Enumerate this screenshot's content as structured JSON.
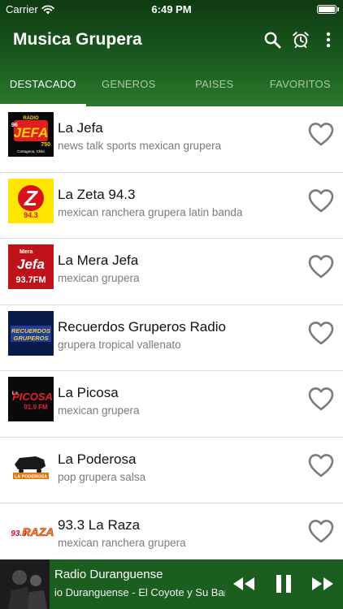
{
  "status": {
    "carrier": "Carrier",
    "time": "6:49 PM"
  },
  "app": {
    "title": "Musica Grupera"
  },
  "tabs": [
    {
      "label": "DESTACADO",
      "active": true
    },
    {
      "label": "GENEROS",
      "active": false
    },
    {
      "label": "PAISES",
      "active": false
    },
    {
      "label": "FAVORITOS",
      "active": false
    }
  ],
  "stations": [
    {
      "name": "La Jefa",
      "tags": "news talk sports mexican grupera"
    },
    {
      "name": "La Zeta 94.3",
      "tags": "mexican ranchera grupera latin banda"
    },
    {
      "name": "La Mera Jefa",
      "tags": "mexican grupera"
    },
    {
      "name": "Recuerdos Gruperos Radio",
      "tags": "grupera tropical vallenato"
    },
    {
      "name": "La Picosa",
      "tags": "mexican grupera"
    },
    {
      "name": "La Poderosa",
      "tags": "pop grupera salsa"
    },
    {
      "name": "93.3 La Raza",
      "tags": "mexican ranchera grupera"
    }
  ],
  "logos": {
    "jefa": {
      "top": "RADIO",
      "main": "JEFA",
      "num1": "96",
      "num2": "750",
      "sub": "Cartagena, Chile"
    },
    "zeta": {
      "main": "Z",
      "num": "94.3"
    },
    "mera": {
      "top": "Mera",
      "main": "Jefa",
      "num": "93.7FM"
    },
    "recuerdos": {
      "line1": "RECUERDOS",
      "line2": "GRUPEROS"
    },
    "picosa": {
      "pre": "La",
      "main": "PICOSA",
      "num": "91.9 FM"
    },
    "poderosa": {
      "main": "LA PODEROSA"
    },
    "raza": {
      "num": "93.3",
      "main": "RAZA"
    }
  },
  "player": {
    "title": "Radio Duranguense",
    "track": "Radio Duranguense - El Coyote y Su Banda - Enc"
  },
  "colors": {
    "header_dark": "#0f3a12",
    "header_light": "#2a7a2c",
    "player": "#1b5e20",
    "heart": "#7b7b7b"
  }
}
